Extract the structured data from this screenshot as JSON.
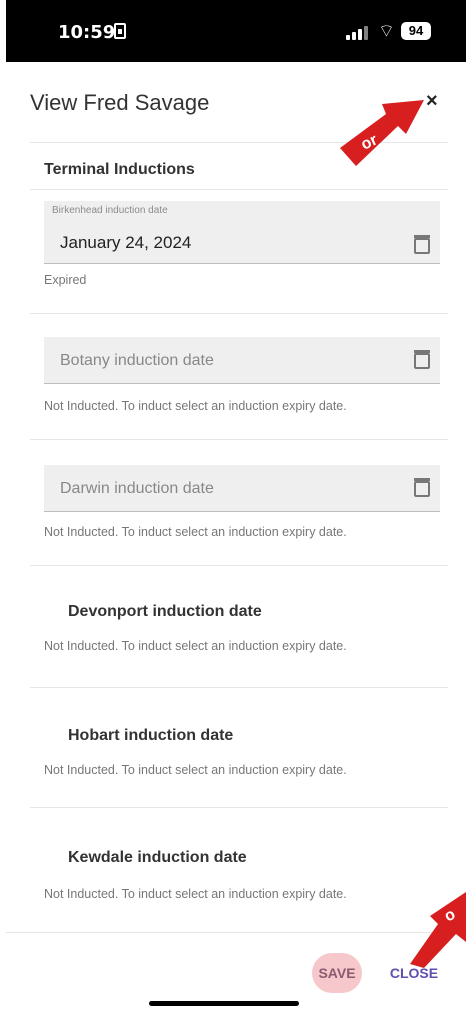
{
  "status_bar": {
    "time": "10:59",
    "battery": "94"
  },
  "header": {
    "title": "View Fred Savage",
    "close_icon": "×"
  },
  "section": {
    "title": "Terminal Inductions"
  },
  "fields": [
    {
      "label": "Birkenhead induction date",
      "value": "January 24, 2024",
      "helper": "Expired"
    },
    {
      "placeholder": "Botany induction date",
      "helper": "Not Inducted. To induct select an induction expiry date."
    },
    {
      "placeholder": "Darwin induction date",
      "helper": "Not Inducted. To induct select an induction expiry date."
    },
    {
      "label": "Devonport induction date",
      "helper": "Not Inducted. To induct select an induction expiry date."
    },
    {
      "label": "Hobart induction date",
      "helper": "Not Inducted. To induct select an induction expiry date."
    },
    {
      "label": "Kewdale induction date",
      "helper": "Not Inducted. To induct select an induction expiry date."
    }
  ],
  "footer": {
    "save_label": "SAVE",
    "close_label": "CLOSE"
  },
  "annotations": {
    "or_label": "or",
    "or_label_partial": "o",
    "arrow_color": "#d81f1f"
  }
}
